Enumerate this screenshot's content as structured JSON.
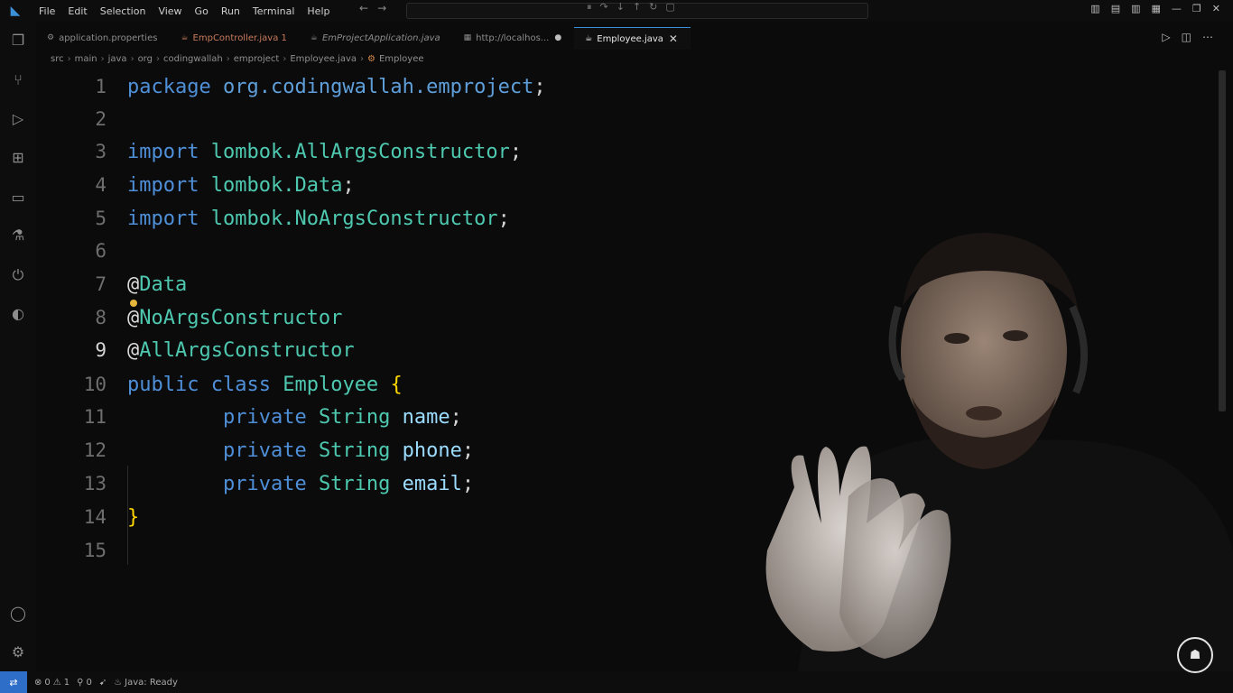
{
  "menu": [
    "File",
    "Edit",
    "Selection",
    "View",
    "Go",
    "Run",
    "Terminal",
    "Help"
  ],
  "tabs": [
    {
      "label": "application.properties",
      "icon": "gear-file-icon"
    },
    {
      "label": "EmpController.java 1",
      "icon": "java-file-icon"
    },
    {
      "label": "EmProjectApplication.java",
      "icon": "java-file-icon"
    },
    {
      "label": "http://localhos...",
      "icon": "browser-icon"
    },
    {
      "label": "Employee.java",
      "icon": "java-file-icon"
    }
  ],
  "breadcrumb": [
    "src",
    "main",
    "java",
    "org",
    "codingwallah",
    "emproject",
    "Employee.java",
    "Employee"
  ],
  "code": {
    "line_numbers": [
      "1",
      "2",
      "3",
      "4",
      "5",
      "6",
      "7",
      "8",
      "9",
      "10",
      "11",
      "12",
      "13",
      "14",
      "15"
    ],
    "current_line": "9",
    "l1": {
      "kw": "package",
      "name": "org.codingwallah.emproject",
      "end": ";"
    },
    "l3": {
      "kw": "import",
      "pkg": "lombok.",
      "cls": "AllArgsConstructor",
      "end": ";"
    },
    "l4": {
      "kw": "import",
      "pkg": "lombok.",
      "cls": "Data",
      "end": ";"
    },
    "l5": {
      "kw": "import",
      "pkg": "lombok.",
      "cls": "NoArgsConstructor",
      "end": ";"
    },
    "l7": {
      "at": "@",
      "ann": "Data"
    },
    "l8": {
      "at": "@",
      "ann": "NoArgsConstructor"
    },
    "l9": {
      "at": "@",
      "ann": "AllArgsConstructor"
    },
    "l10": {
      "kw1": "public",
      "kw2": "class",
      "cls": "Employee",
      "brace": "{"
    },
    "l11": {
      "kw": "private",
      "type": "String",
      "field": "name",
      "end": ";"
    },
    "l12": {
      "kw": "private",
      "type": "String",
      "field": "phone",
      "end": ";"
    },
    "l13": {
      "kw": "private",
      "type": "String",
      "field": "email",
      "end": ";"
    },
    "l14": {
      "brace": "}"
    }
  },
  "status": {
    "errors": "0",
    "warnings": "1",
    "ports": "0",
    "java": "Java: Ready"
  },
  "colors": {
    "accent": "#3b8fd6",
    "background": "#0b0b0c"
  }
}
